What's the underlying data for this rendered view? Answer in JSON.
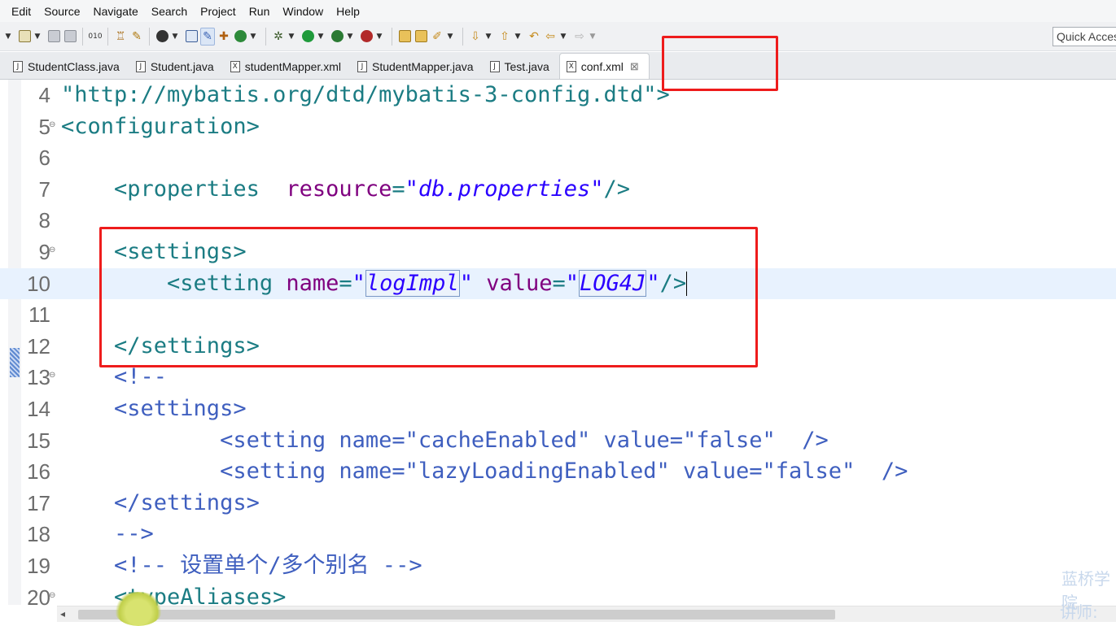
{
  "menu": [
    "Edit",
    "Source",
    "Navigate",
    "Search",
    "Project",
    "Run",
    "Window",
    "Help"
  ],
  "quick_access": {
    "placeholder": "Quick Access"
  },
  "tabs": [
    {
      "label": "StudentClass.java",
      "icon": "java-file-icon"
    },
    {
      "label": "Student.java",
      "icon": "java-file-icon"
    },
    {
      "label": "studentMapper.xml",
      "icon": "xml-file-icon"
    },
    {
      "label": "StudentMapper.java",
      "icon": "java-file-icon"
    },
    {
      "label": "Test.java",
      "icon": "java-file-icon"
    },
    {
      "label": "conf.xml",
      "icon": "xml-file-icon",
      "active": true
    }
  ],
  "editor": {
    "lines": [
      {
        "num": "4",
        "fold": "",
        "code": [
          [
            "plain",
            "\"http://mybatis.org/dtd/mybatis-3-config.dtd\">"
          ]
        ]
      },
      {
        "num": "5",
        "fold": "⊖",
        "code": [
          [
            "tag",
            "<configuration>"
          ]
        ]
      },
      {
        "num": "6",
        "fold": "",
        "code": []
      },
      {
        "num": "7",
        "fold": "",
        "code": [
          [
            "tag",
            "    <properties  "
          ],
          [
            "attr",
            "resource"
          ],
          [
            "tag",
            "="
          ],
          [
            "str",
            "\"db.properties\""
          ],
          [
            "tag",
            "/>"
          ]
        ]
      },
      {
        "num": "8",
        "fold": "",
        "code": []
      },
      {
        "num": "9",
        "fold": "⊖",
        "code": [
          [
            "tag",
            "    <settings>"
          ]
        ]
      },
      {
        "num": "10",
        "fold": "",
        "current": true,
        "code": [
          [
            "tag",
            "        <setting "
          ],
          [
            "attr",
            "name"
          ],
          [
            "tag",
            "="
          ],
          [
            "str",
            "\""
          ],
          [
            "strbox",
            "logImpl"
          ],
          [
            "str",
            "\" "
          ],
          [
            "attr",
            "value"
          ],
          [
            "tag",
            "="
          ],
          [
            "str",
            "\""
          ],
          [
            "strbox",
            "LOG4J"
          ],
          [
            "str",
            "\""
          ],
          [
            "tag",
            "/>"
          ]
        ]
      },
      {
        "num": "11",
        "fold": "",
        "code": []
      },
      {
        "num": "12",
        "fold": "",
        "code": [
          [
            "tag",
            "    </settings>"
          ]
        ]
      },
      {
        "num": "13",
        "fold": "⊖",
        "code": [
          [
            "cmt",
            "    <!--"
          ]
        ]
      },
      {
        "num": "14",
        "fold": "",
        "code": [
          [
            "cmt",
            "    <settings>"
          ]
        ]
      },
      {
        "num": "15",
        "fold": "",
        "code": [
          [
            "cmt",
            "            <setting name=\"cacheEnabled\" value=\"false\"  />"
          ]
        ]
      },
      {
        "num": "16",
        "fold": "",
        "code": [
          [
            "cmt",
            "            <setting name=\"lazyLoadingEnabled\" value=\"false\"  />"
          ]
        ]
      },
      {
        "num": "17",
        "fold": "",
        "code": [
          [
            "cmt",
            "    </settings>"
          ]
        ]
      },
      {
        "num": "18",
        "fold": "",
        "code": [
          [
            "cmt",
            "    -->"
          ]
        ]
      },
      {
        "num": "19",
        "fold": "",
        "code": [
          [
            "cmt",
            "    <!-- 设置单个/多个别名 -->"
          ]
        ]
      },
      {
        "num": "20",
        "fold": "⊖",
        "code": [
          [
            "tag",
            "    <typeAliases>"
          ]
        ]
      }
    ]
  },
  "watermark": {
    "line1": "蓝桥学院",
    "line2": "讲师: 颜"
  },
  "colors": {
    "tag": "#1b7c83",
    "attr": "#7f007f",
    "string": "#2a00ff",
    "comment": "#3f5fbf",
    "highlight": "#ee1c1c"
  }
}
